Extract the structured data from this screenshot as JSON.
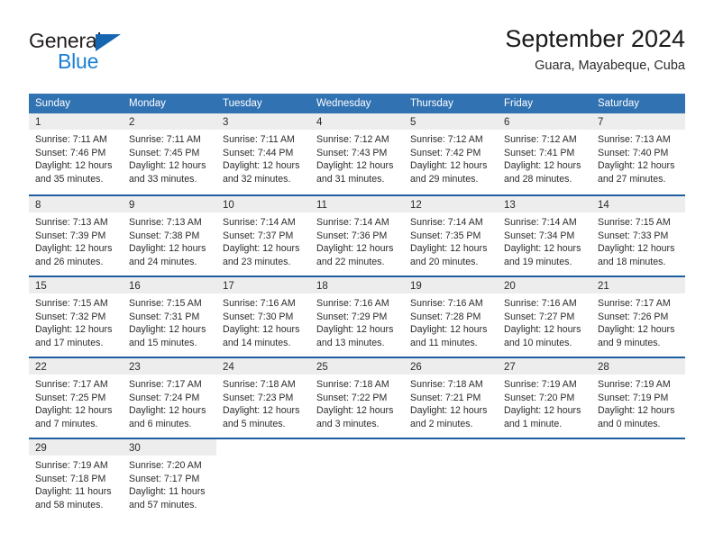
{
  "logo": {
    "word1": "General",
    "word2": "Blue",
    "triangle_color": "#1565b0",
    "blue_color": "#1a7fd4"
  },
  "header": {
    "title": "September 2024",
    "location": "Guara, Mayabeque, Cuba"
  },
  "theme": {
    "header_bg": "#3172b3",
    "header_text": "#ffffff",
    "week_border": "#1f5fa0",
    "daynum_bar": "#ededed",
    "body_text": "#2b2b2b"
  },
  "weekdays": [
    "Sunday",
    "Monday",
    "Tuesday",
    "Wednesday",
    "Thursday",
    "Friday",
    "Saturday"
  ],
  "weeks": [
    [
      {
        "day": "1",
        "sunrise": "Sunrise: 7:11 AM",
        "sunset": "Sunset: 7:46 PM",
        "daylight1": "Daylight: 12 hours",
        "daylight2": "and 35 minutes."
      },
      {
        "day": "2",
        "sunrise": "Sunrise: 7:11 AM",
        "sunset": "Sunset: 7:45 PM",
        "daylight1": "Daylight: 12 hours",
        "daylight2": "and 33 minutes."
      },
      {
        "day": "3",
        "sunrise": "Sunrise: 7:11 AM",
        "sunset": "Sunset: 7:44 PM",
        "daylight1": "Daylight: 12 hours",
        "daylight2": "and 32 minutes."
      },
      {
        "day": "4",
        "sunrise": "Sunrise: 7:12 AM",
        "sunset": "Sunset: 7:43 PM",
        "daylight1": "Daylight: 12 hours",
        "daylight2": "and 31 minutes."
      },
      {
        "day": "5",
        "sunrise": "Sunrise: 7:12 AM",
        "sunset": "Sunset: 7:42 PM",
        "daylight1": "Daylight: 12 hours",
        "daylight2": "and 29 minutes."
      },
      {
        "day": "6",
        "sunrise": "Sunrise: 7:12 AM",
        "sunset": "Sunset: 7:41 PM",
        "daylight1": "Daylight: 12 hours",
        "daylight2": "and 28 minutes."
      },
      {
        "day": "7",
        "sunrise": "Sunrise: 7:13 AM",
        "sunset": "Sunset: 7:40 PM",
        "daylight1": "Daylight: 12 hours",
        "daylight2": "and 27 minutes."
      }
    ],
    [
      {
        "day": "8",
        "sunrise": "Sunrise: 7:13 AM",
        "sunset": "Sunset: 7:39 PM",
        "daylight1": "Daylight: 12 hours",
        "daylight2": "and 26 minutes."
      },
      {
        "day": "9",
        "sunrise": "Sunrise: 7:13 AM",
        "sunset": "Sunset: 7:38 PM",
        "daylight1": "Daylight: 12 hours",
        "daylight2": "and 24 minutes."
      },
      {
        "day": "10",
        "sunrise": "Sunrise: 7:14 AM",
        "sunset": "Sunset: 7:37 PM",
        "daylight1": "Daylight: 12 hours",
        "daylight2": "and 23 minutes."
      },
      {
        "day": "11",
        "sunrise": "Sunrise: 7:14 AM",
        "sunset": "Sunset: 7:36 PM",
        "daylight1": "Daylight: 12 hours",
        "daylight2": "and 22 minutes."
      },
      {
        "day": "12",
        "sunrise": "Sunrise: 7:14 AM",
        "sunset": "Sunset: 7:35 PM",
        "daylight1": "Daylight: 12 hours",
        "daylight2": "and 20 minutes."
      },
      {
        "day": "13",
        "sunrise": "Sunrise: 7:14 AM",
        "sunset": "Sunset: 7:34 PM",
        "daylight1": "Daylight: 12 hours",
        "daylight2": "and 19 minutes."
      },
      {
        "day": "14",
        "sunrise": "Sunrise: 7:15 AM",
        "sunset": "Sunset: 7:33 PM",
        "daylight1": "Daylight: 12 hours",
        "daylight2": "and 18 minutes."
      }
    ],
    [
      {
        "day": "15",
        "sunrise": "Sunrise: 7:15 AM",
        "sunset": "Sunset: 7:32 PM",
        "daylight1": "Daylight: 12 hours",
        "daylight2": "and 17 minutes."
      },
      {
        "day": "16",
        "sunrise": "Sunrise: 7:15 AM",
        "sunset": "Sunset: 7:31 PM",
        "daylight1": "Daylight: 12 hours",
        "daylight2": "and 15 minutes."
      },
      {
        "day": "17",
        "sunrise": "Sunrise: 7:16 AM",
        "sunset": "Sunset: 7:30 PM",
        "daylight1": "Daylight: 12 hours",
        "daylight2": "and 14 minutes."
      },
      {
        "day": "18",
        "sunrise": "Sunrise: 7:16 AM",
        "sunset": "Sunset: 7:29 PM",
        "daylight1": "Daylight: 12 hours",
        "daylight2": "and 13 minutes."
      },
      {
        "day": "19",
        "sunrise": "Sunrise: 7:16 AM",
        "sunset": "Sunset: 7:28 PM",
        "daylight1": "Daylight: 12 hours",
        "daylight2": "and 11 minutes."
      },
      {
        "day": "20",
        "sunrise": "Sunrise: 7:16 AM",
        "sunset": "Sunset: 7:27 PM",
        "daylight1": "Daylight: 12 hours",
        "daylight2": "and 10 minutes."
      },
      {
        "day": "21",
        "sunrise": "Sunrise: 7:17 AM",
        "sunset": "Sunset: 7:26 PM",
        "daylight1": "Daylight: 12 hours",
        "daylight2": "and 9 minutes."
      }
    ],
    [
      {
        "day": "22",
        "sunrise": "Sunrise: 7:17 AM",
        "sunset": "Sunset: 7:25 PM",
        "daylight1": "Daylight: 12 hours",
        "daylight2": "and 7 minutes."
      },
      {
        "day": "23",
        "sunrise": "Sunrise: 7:17 AM",
        "sunset": "Sunset: 7:24 PM",
        "daylight1": "Daylight: 12 hours",
        "daylight2": "and 6 minutes."
      },
      {
        "day": "24",
        "sunrise": "Sunrise: 7:18 AM",
        "sunset": "Sunset: 7:23 PM",
        "daylight1": "Daylight: 12 hours",
        "daylight2": "and 5 minutes."
      },
      {
        "day": "25",
        "sunrise": "Sunrise: 7:18 AM",
        "sunset": "Sunset: 7:22 PM",
        "daylight1": "Daylight: 12 hours",
        "daylight2": "and 3 minutes."
      },
      {
        "day": "26",
        "sunrise": "Sunrise: 7:18 AM",
        "sunset": "Sunset: 7:21 PM",
        "daylight1": "Daylight: 12 hours",
        "daylight2": "and 2 minutes."
      },
      {
        "day": "27",
        "sunrise": "Sunrise: 7:19 AM",
        "sunset": "Sunset: 7:20 PM",
        "daylight1": "Daylight: 12 hours",
        "daylight2": "and 1 minute."
      },
      {
        "day": "28",
        "sunrise": "Sunrise: 7:19 AM",
        "sunset": "Sunset: 7:19 PM",
        "daylight1": "Daylight: 12 hours",
        "daylight2": "and 0 minutes."
      }
    ],
    [
      {
        "day": "29",
        "sunrise": "Sunrise: 7:19 AM",
        "sunset": "Sunset: 7:18 PM",
        "daylight1": "Daylight: 11 hours",
        "daylight2": "and 58 minutes."
      },
      {
        "day": "30",
        "sunrise": "Sunrise: 7:20 AM",
        "sunset": "Sunset: 7:17 PM",
        "daylight1": "Daylight: 11 hours",
        "daylight2": "and 57 minutes."
      },
      {
        "day": "",
        "sunrise": "",
        "sunset": "",
        "daylight1": "",
        "daylight2": ""
      },
      {
        "day": "",
        "sunrise": "",
        "sunset": "",
        "daylight1": "",
        "daylight2": ""
      },
      {
        "day": "",
        "sunrise": "",
        "sunset": "",
        "daylight1": "",
        "daylight2": ""
      },
      {
        "day": "",
        "sunrise": "",
        "sunset": "",
        "daylight1": "",
        "daylight2": ""
      },
      {
        "day": "",
        "sunrise": "",
        "sunset": "",
        "daylight1": "",
        "daylight2": ""
      }
    ]
  ]
}
